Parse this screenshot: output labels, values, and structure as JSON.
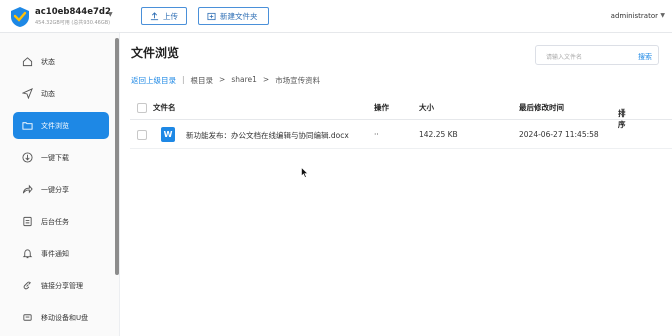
{
  "header": {
    "device_name": "ac10eb844e7d2",
    "device_sub": "454.32GB可用 (总共930.46GB)",
    "upload_label": "上传",
    "new_folder_label": "新建文件夹",
    "user": "administrator"
  },
  "sidebar": {
    "items": [
      {
        "label": "状态",
        "icon": "status-icon"
      },
      {
        "label": "动态",
        "icon": "send-icon"
      },
      {
        "label": "文件浏览",
        "icon": "folder-icon",
        "active": true
      },
      {
        "label": "一键下载",
        "icon": "download-icon"
      },
      {
        "label": "一键分享",
        "icon": "share-icon"
      },
      {
        "label": "后台任务",
        "icon": "task-icon"
      },
      {
        "label": "事件通知",
        "icon": "bell-icon"
      },
      {
        "label": "链接分享管理",
        "icon": "link-icon"
      },
      {
        "label": "移动设备和U盘",
        "icon": "usb-icon"
      }
    ]
  },
  "main": {
    "title": "文件浏览",
    "search_placeholder": "请输入文件名",
    "search_button": "搜索",
    "breadcrumb": {
      "back": "返回上级目录",
      "separator": "|",
      "items": [
        "根目录",
        ">",
        "share1",
        ">",
        "市场宣传资料"
      ]
    },
    "columns": {
      "name": "文件名",
      "action": "操作",
      "size": "大小",
      "modified": "最后修改时间",
      "sort": "排序"
    },
    "files": [
      {
        "icon_letter": "W",
        "name": "新功能发布：办公文档在线编辑与协同编辑.docx",
        "action": "··",
        "size": "142.25 KB",
        "modified": "2024-06-27 11:45:58"
      }
    ]
  },
  "colors": {
    "accent": "#1e88e5"
  }
}
